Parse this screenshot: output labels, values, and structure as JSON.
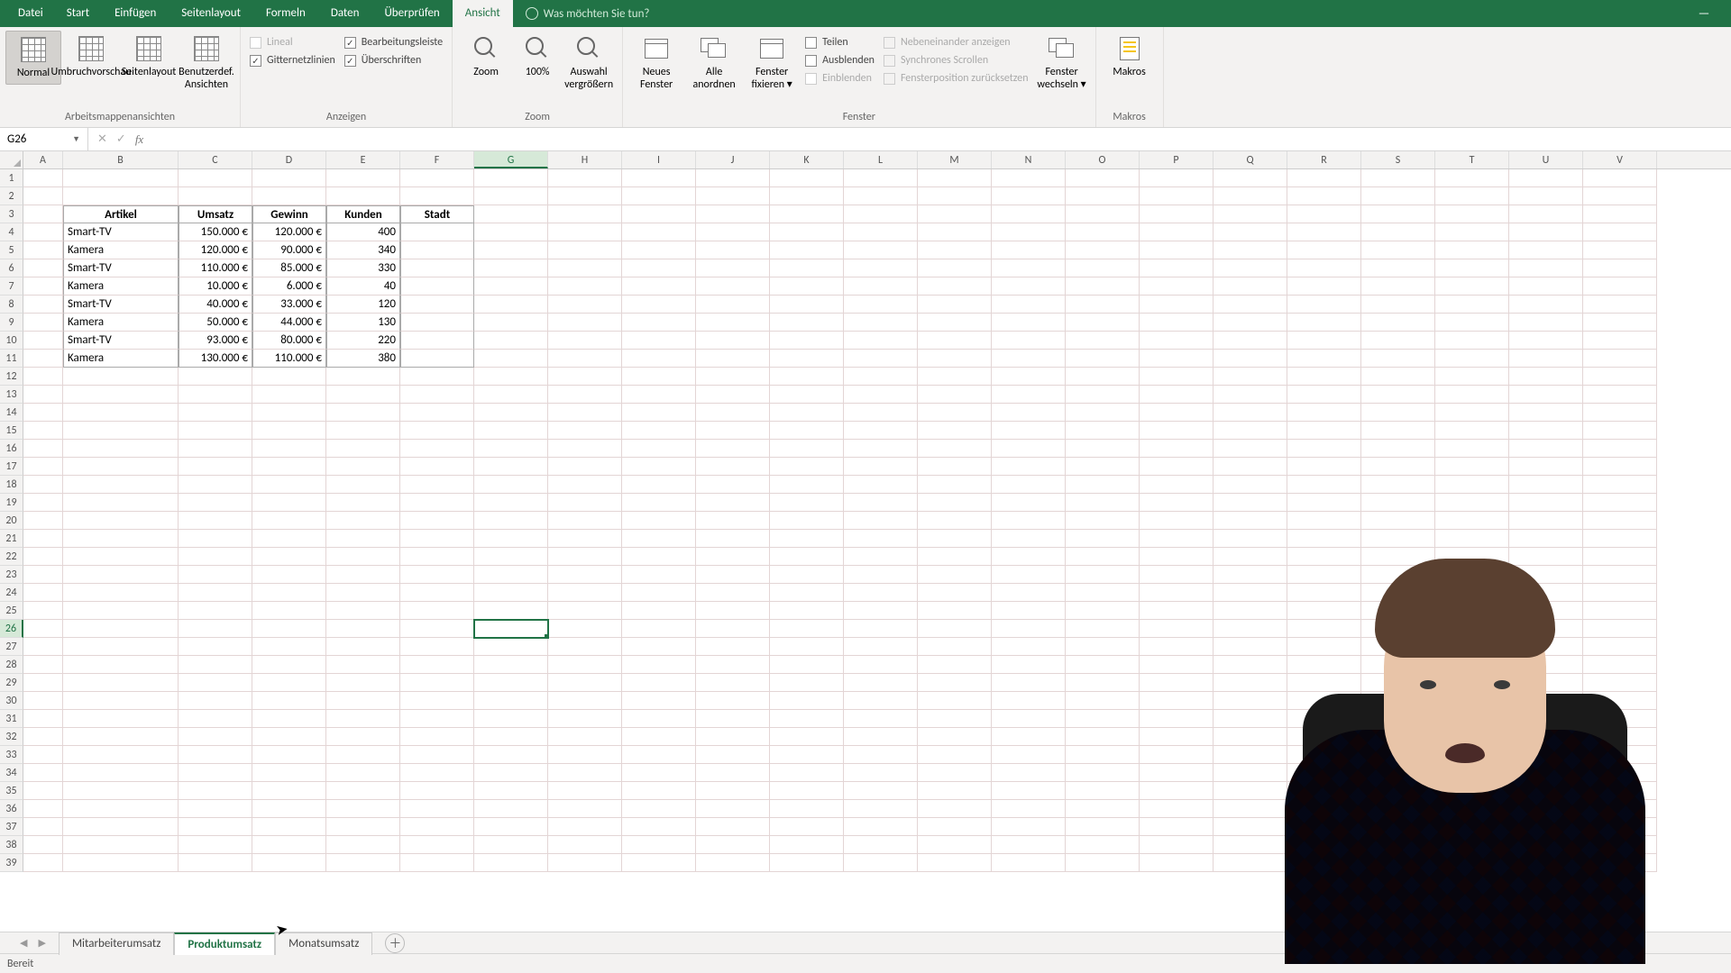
{
  "menubar": {
    "file": "Datei",
    "tabs": [
      "Start",
      "Einfügen",
      "Seitenlayout",
      "Formeln",
      "Daten",
      "Überprüfen",
      "Ansicht"
    ],
    "active": "Ansicht",
    "tell_me": "Was möchten Sie tun?"
  },
  "ribbon": {
    "views": {
      "normal": "Normal",
      "page_break": "Umbruchvorschau",
      "page_layout": "Seitenlayout",
      "custom": "Benutzerdef. Ansichten",
      "group": "Arbeitsmappenansichten"
    },
    "show": {
      "ruler": "Lineal",
      "formula_bar": "Bearbeitungsleiste",
      "gridlines": "Gitternetzlinien",
      "headings": "Überschriften",
      "group": "Anzeigen"
    },
    "zoom": {
      "zoom": "Zoom",
      "hundred": "100%",
      "selection": "Auswahl vergrößern",
      "group": "Zoom"
    },
    "window": {
      "new": "Neues Fenster",
      "arrange": "Alle anordnen",
      "freeze": "Fenster fixieren ▾",
      "split": "Teilen",
      "hide": "Ausblenden",
      "unhide": "Einblenden",
      "side_by_side": "Nebeneinander anzeigen",
      "sync_scroll": "Synchrones Scrollen",
      "reset_pos": "Fensterposition zurücksetzen",
      "switch": "Fenster wechseln ▾",
      "group": "Fenster"
    },
    "macros": {
      "label": "Makros",
      "group": "Makros"
    }
  },
  "namebox": "G26",
  "columns": [
    "A",
    "B",
    "C",
    "D",
    "E",
    "F",
    "G",
    "H",
    "I",
    "J",
    "K",
    "L",
    "M",
    "N",
    "O",
    "P",
    "Q",
    "R",
    "S",
    "T",
    "U",
    "V"
  ],
  "table": {
    "headers": {
      "artikel": "Artikel",
      "umsatz": "Umsatz",
      "gewinn": "Gewinn",
      "kunden": "Kunden",
      "stadt": "Stadt"
    },
    "rows": [
      {
        "artikel": "Smart-TV",
        "umsatz": "150.000 €",
        "gewinn": "120.000 €",
        "kunden": "400"
      },
      {
        "artikel": "Kamera",
        "umsatz": "120.000 €",
        "gewinn": "90.000 €",
        "kunden": "340"
      },
      {
        "artikel": "Smart-TV",
        "umsatz": "110.000 €",
        "gewinn": "85.000 €",
        "kunden": "330"
      },
      {
        "artikel": "Kamera",
        "umsatz": "10.000 €",
        "gewinn": "6.000 €",
        "kunden": "40"
      },
      {
        "artikel": "Smart-TV",
        "umsatz": "40.000 €",
        "gewinn": "33.000 €",
        "kunden": "120"
      },
      {
        "artikel": "Kamera",
        "umsatz": "50.000 €",
        "gewinn": "44.000 €",
        "kunden": "130"
      },
      {
        "artikel": "Smart-TV",
        "umsatz": "93.000 €",
        "gewinn": "80.000 €",
        "kunden": "220"
      },
      {
        "artikel": "Kamera",
        "umsatz": "130.000 €",
        "gewinn": "110.000 €",
        "kunden": "380"
      }
    ]
  },
  "active_cell": {
    "col": "G",
    "row": 26
  },
  "sheets": {
    "tabs": [
      "Mitarbeiterumsatz",
      "Produktumsatz",
      "Monatsumsatz"
    ],
    "active": "Produktumsatz"
  },
  "status": "Bereit"
}
